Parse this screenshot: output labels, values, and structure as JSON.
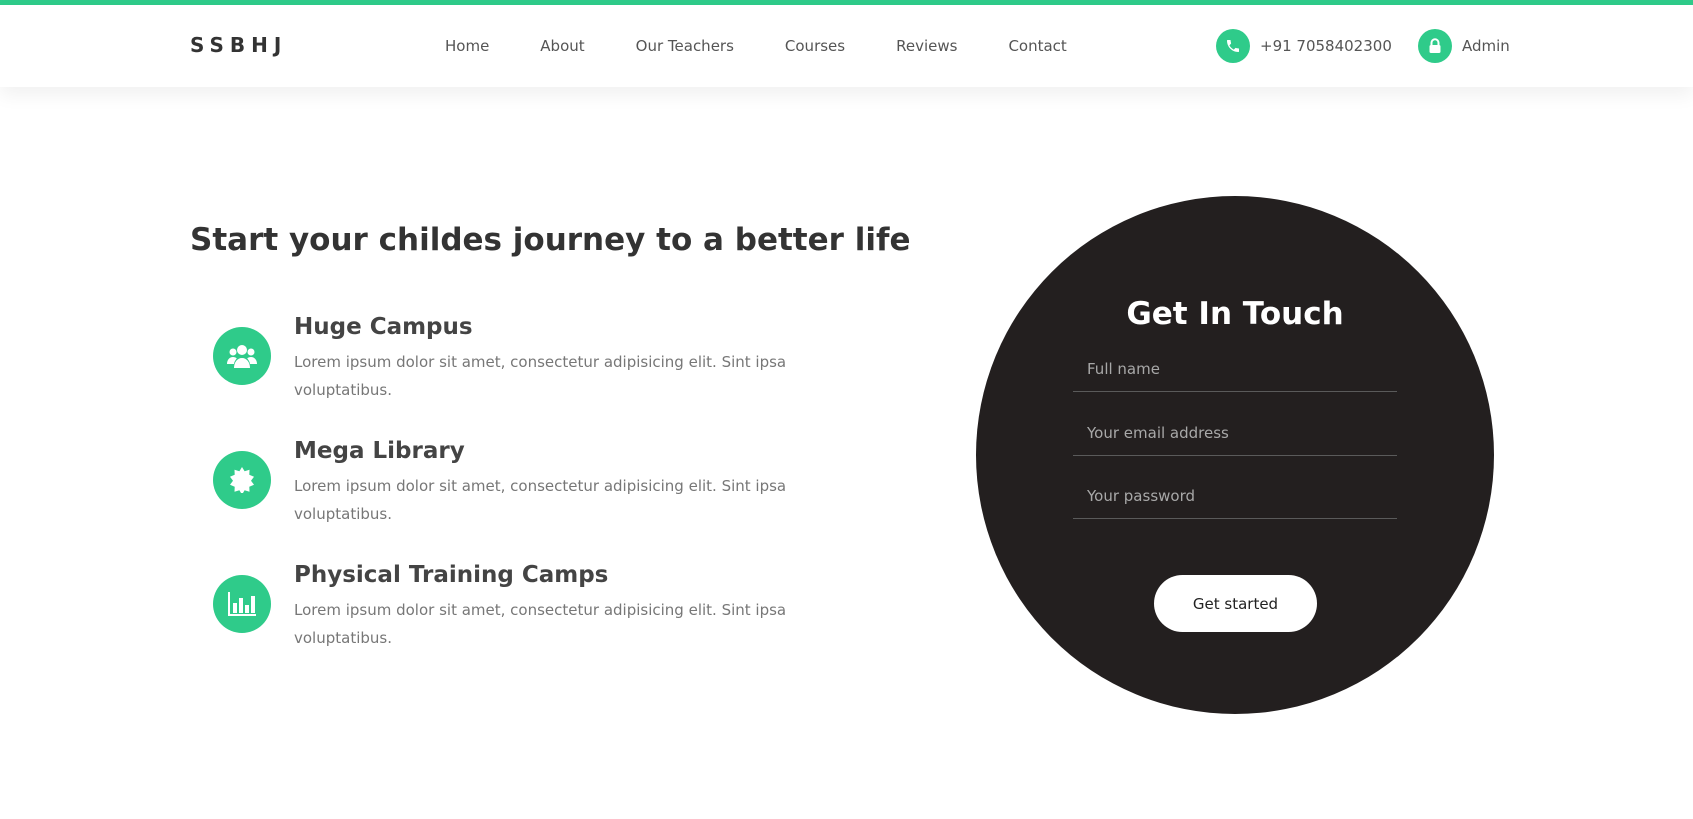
{
  "brand": {
    "logo": "SSBHJ",
    "accent_color": "#2fcb8a",
    "dark_color": "#231f1f"
  },
  "nav": {
    "items": [
      {
        "label": "Home"
      },
      {
        "label": "About"
      },
      {
        "label": "Our Teachers"
      },
      {
        "label": "Courses"
      },
      {
        "label": "Reviews"
      },
      {
        "label": "Contact"
      }
    ]
  },
  "header_actions": {
    "phone": {
      "icon": "phone-icon",
      "label": "+91 7058402300"
    },
    "admin": {
      "icon": "lock-icon",
      "label": "Admin"
    }
  },
  "hero": {
    "title": "Start your childes journey to a better life"
  },
  "features": [
    {
      "icon": "users-icon",
      "title": "Huge Campus",
      "description": "Lorem ipsum dolor sit amet, consectetur adipisicing elit. Sint ipsa voluptatibus."
    },
    {
      "icon": "badge-icon",
      "title": "Mega Library",
      "description": "Lorem ipsum dolor sit amet, consectetur adipisicing elit. Sint ipsa voluptatibus."
    },
    {
      "icon": "bar-chart-icon",
      "title": "Physical Training Camps",
      "description": "Lorem ipsum dolor sit amet, consectetur adipisicing elit. Sint ipsa voluptatibus."
    }
  ],
  "contact_form": {
    "title": "Get In Touch",
    "fullname_placeholder": "Full name",
    "email_placeholder": "Your email address",
    "password_placeholder": "Your password",
    "submit_label": "Get started"
  }
}
